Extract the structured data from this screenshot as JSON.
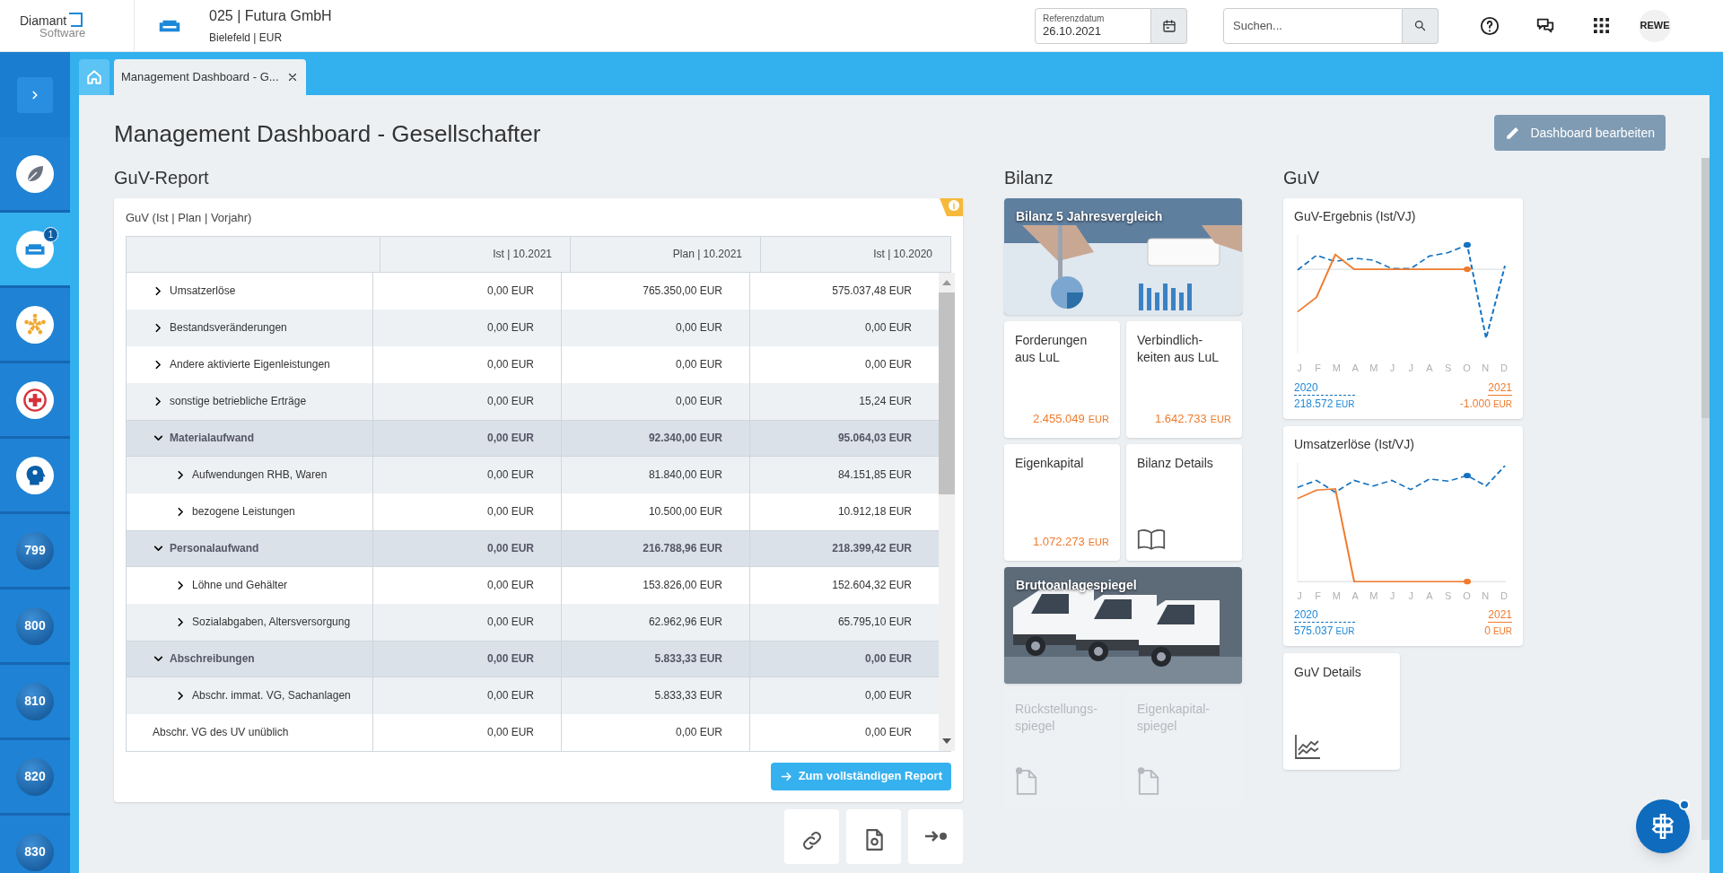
{
  "header": {
    "logo_line1": "Diamant",
    "logo_line2": "Software",
    "company": "025 | Futura GmbH",
    "company_sub": "Bielefeld | EUR",
    "date_field": {
      "label": "Referenzdatum",
      "value": "26.10.2021"
    },
    "search": {
      "placeholder": "Suchen..."
    },
    "user": "REWE"
  },
  "sidebar": {
    "items": [
      {
        "kind": "icon",
        "selected": false
      },
      {
        "kind": "icon",
        "selected": true,
        "badge": "1"
      },
      {
        "kind": "icon",
        "selected": false
      },
      {
        "kind": "icon",
        "selected": false
      },
      {
        "kind": "icon",
        "selected": false
      },
      {
        "kind": "number",
        "label": "799",
        "selected": false
      },
      {
        "kind": "number",
        "label": "800",
        "selected": false
      },
      {
        "kind": "number",
        "label": "810",
        "selected": false
      },
      {
        "kind": "number",
        "label": "820",
        "selected": false
      },
      {
        "kind": "number",
        "label": "830",
        "selected": false
      }
    ]
  },
  "tabs": [
    {
      "label": "Management Dashboard - G...",
      "selected": true
    }
  ],
  "page": {
    "title": "Management Dashboard - Gesellschafter",
    "edit_button": "Dashboard bearbeiten"
  },
  "report": {
    "heading": "GuV-Report",
    "card_title": "GuV (Ist | Plan | Vorjahr)",
    "columns": [
      "Ist | 10.2021",
      "Plan | 10.2021",
      "Ist | 10.2020"
    ],
    "rows": [
      {
        "label": "Umsatzerlöse",
        "expanded": false,
        "values": [
          "0,00 EUR",
          "765.350,00 EUR",
          "575.037,48 EUR"
        ]
      },
      {
        "label": "Bestandsveränderungen",
        "expanded": false,
        "values": [
          "0,00 EUR",
          "0,00 EUR",
          "0,00 EUR"
        ]
      },
      {
        "label": "Andere aktivierte Eigenleistungen",
        "expanded": false,
        "values": [
          "0,00 EUR",
          "0,00 EUR",
          "0,00 EUR"
        ]
      },
      {
        "label": "sonstige betriebliche Erträge",
        "expanded": false,
        "values": [
          "0,00 EUR",
          "0,00 EUR",
          "15,24 EUR"
        ]
      },
      {
        "label": "Materialaufwand",
        "expanded": true,
        "values": [
          "0,00 EUR",
          "92.340,00 EUR",
          "95.064,03 EUR"
        ],
        "children": [
          {
            "label": "Aufwendungen RHB, Waren",
            "expanded": false,
            "values": [
              "0,00 EUR",
              "81.840,00 EUR",
              "84.151,85 EUR"
            ]
          },
          {
            "label": "bezogene Leistungen",
            "expanded": false,
            "values": [
              "0,00 EUR",
              "10.500,00 EUR",
              "10.912,18 EUR"
            ]
          }
        ]
      },
      {
        "label": "Personalaufwand",
        "expanded": true,
        "values": [
          "0,00 EUR",
          "216.788,96 EUR",
          "218.399,42 EUR"
        ],
        "children": [
          {
            "label": "Löhne und Gehälter",
            "expanded": false,
            "values": [
              "0,00 EUR",
              "153.826,00 EUR",
              "152.604,32 EUR"
            ]
          },
          {
            "label": "Sozialabgaben, Altersversorgung",
            "expanded": false,
            "values": [
              "0,00 EUR",
              "62.962,96 EUR",
              "65.795,10 EUR"
            ]
          }
        ]
      },
      {
        "label": "Abschreibungen",
        "expanded": true,
        "values": [
          "0,00 EUR",
          "5.833,33 EUR",
          "0,00 EUR"
        ],
        "children": [
          {
            "label": "Abschr. immat. VG, Sachanlagen",
            "expanded": false,
            "values": [
              "0,00 EUR",
              "5.833,33 EUR",
              "0,00 EUR"
            ]
          }
        ]
      },
      {
        "label": "Abschr. VG des UV unüblich",
        "values": [
          "0,00 EUR",
          "0,00 EUR",
          "0,00 EUR"
        ]
      }
    ],
    "report_button": "Zum vollständigen Report"
  },
  "bilanz": {
    "heading": "Bilanz",
    "tiles": [
      {
        "title": "Bilanz 5 Jahresvergleich"
      },
      {
        "kind": "value",
        "title": "Forderungen aus LuL",
        "value": "2.455.049",
        "unit": "EUR"
      },
      {
        "kind": "value",
        "title": "Verbindlich-keiten aus LuL",
        "value": "1.642.733",
        "unit": "EUR"
      },
      {
        "kind": "value",
        "title": "Eigenkapital",
        "value": "1.072.273",
        "unit": "EUR"
      },
      {
        "kind": "link",
        "title": "Bilanz Details",
        "disabled": false
      },
      {
        "title": "Bruttoanlagespiegel"
      },
      {
        "kind": "link",
        "title": "Rückstellungs-spiegel",
        "disabled": true
      },
      {
        "kind": "link",
        "title": "Eigenkapital-spiegel",
        "disabled": true
      }
    ]
  },
  "guv": {
    "heading": "GuV",
    "tiles": [
      {
        "kind": "chart",
        "title": "GuV-Ergebnis (Ist/VJ)",
        "months": [
          "J",
          "F",
          "M",
          "A",
          "M",
          "J",
          "J",
          "A",
          "S",
          "O",
          "N",
          "D"
        ],
        "prev_year": "2020",
        "prev_value": "218.572",
        "prev_unit": "EUR",
        "cur_year": "2021",
        "cur_value": "-1.000",
        "cur_unit": "EUR"
      },
      {
        "kind": "chart",
        "title": "Umsatzerlöse (Ist/VJ)",
        "months": [
          "J",
          "F",
          "M",
          "A",
          "M",
          "J",
          "J",
          "A",
          "S",
          "O",
          "N",
          "D"
        ],
        "prev_year": "2020",
        "prev_value": "575.037",
        "prev_unit": "EUR",
        "cur_year": "2021",
        "cur_value": "0",
        "cur_unit": "EUR"
      },
      {
        "kind": "link",
        "title": "GuV Details",
        "disabled": false
      }
    ]
  },
  "help_fab": {
    "notification": true
  }
}
